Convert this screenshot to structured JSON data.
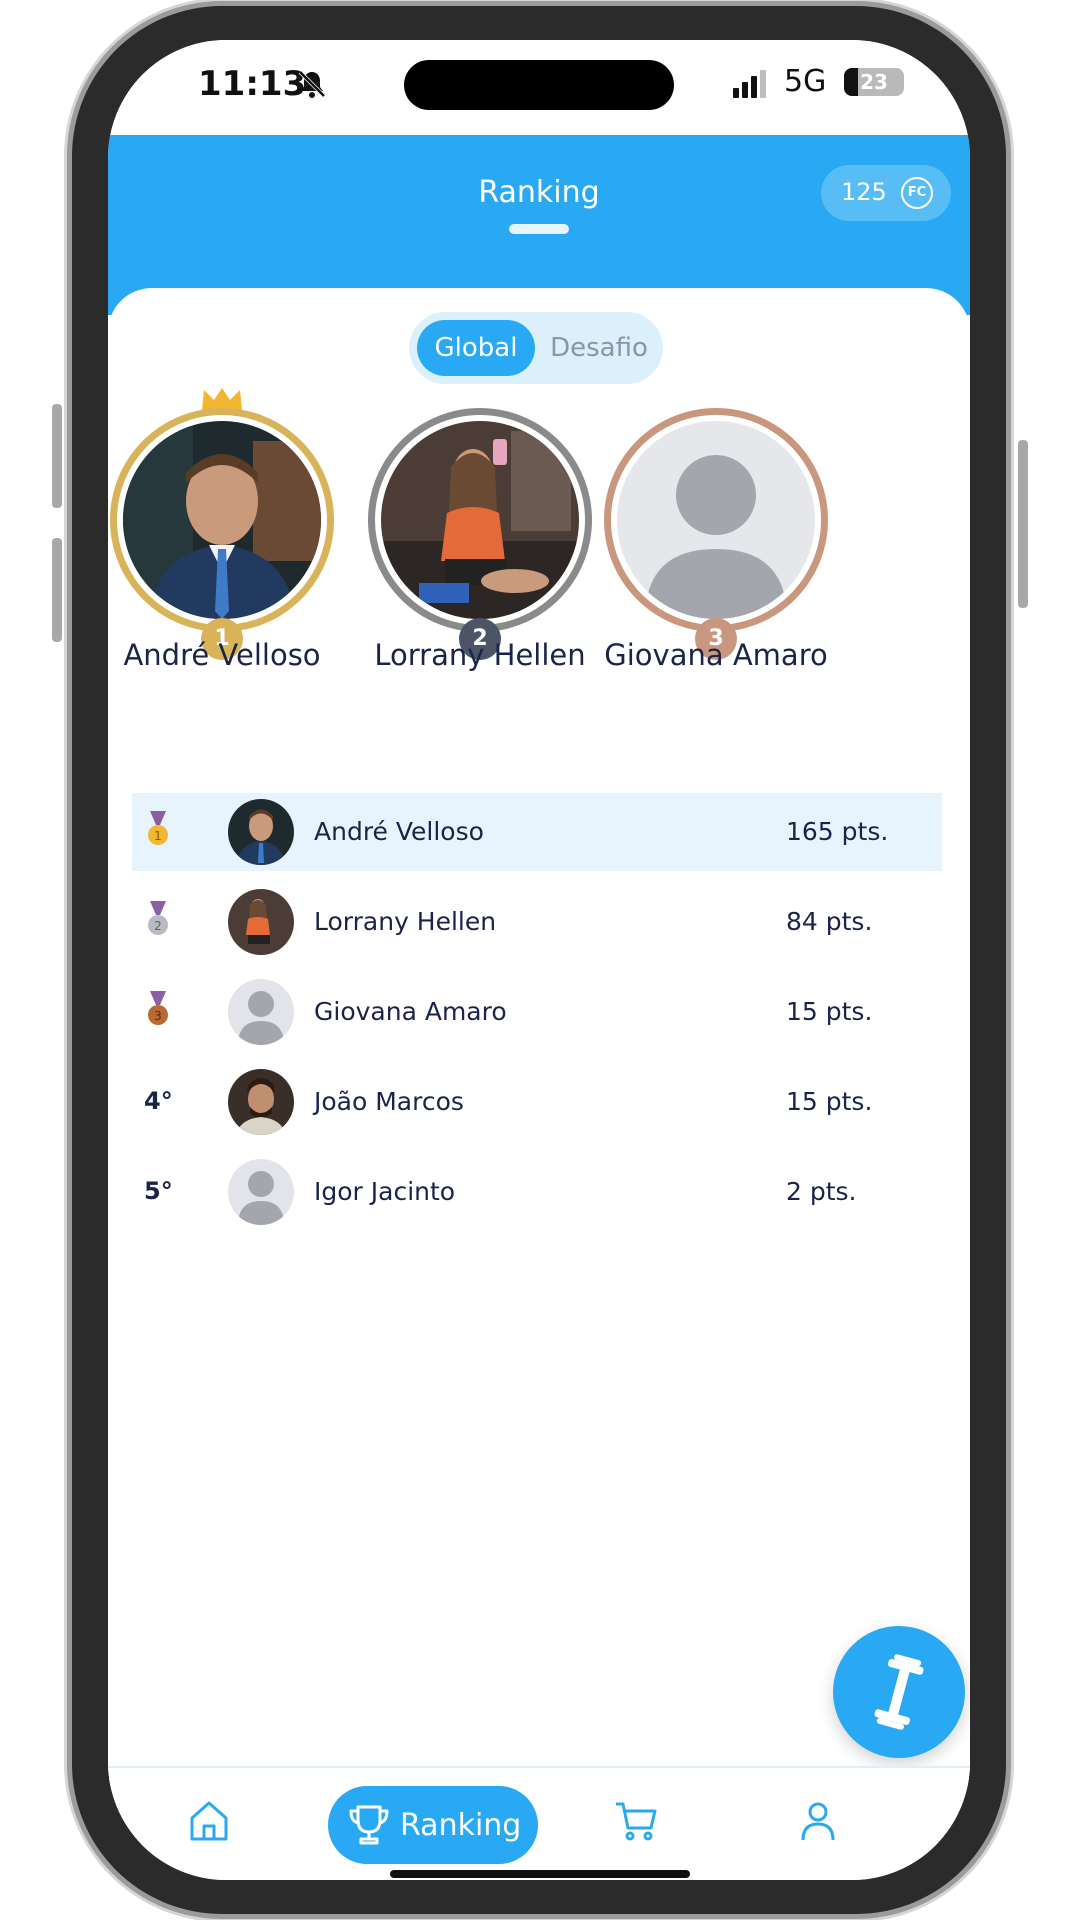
{
  "status_bar": {
    "time": "11:13",
    "network": "5G",
    "battery": "23",
    "battery_level": 0.23
  },
  "header": {
    "title": "Ranking",
    "coins": "125",
    "coin_label": "FC"
  },
  "toggle": {
    "active": "Global",
    "inactive": "Desafio"
  },
  "podium": [
    {
      "rank": "1",
      "name": "André Velloso"
    },
    {
      "rank": "2",
      "name": "Lorrany Hellen"
    },
    {
      "rank": "3",
      "name": "Giovana Amaro"
    }
  ],
  "ranking": [
    {
      "rank": "1",
      "medal": "gold-medal-icon",
      "name": "André Velloso",
      "points": "165 pts."
    },
    {
      "rank": "2",
      "medal": "silver-medal-icon",
      "name": "Lorrany Hellen",
      "points": "84 pts."
    },
    {
      "rank": "3",
      "medal": "bronze-medal-icon",
      "name": "Giovana Amaro",
      "points": "15 pts."
    },
    {
      "rank": "4°",
      "name": "João Marcos",
      "points": "15 pts."
    },
    {
      "rank": "5°",
      "name": "Igor Jacinto",
      "points": "2 pts."
    }
  ],
  "nav": {
    "active_label": "Ranking"
  },
  "colors": {
    "primary": "#29a9f3",
    "gold": "#d8b35a",
    "silver": "#8a8a8a",
    "bronze": "#c9977d",
    "text": "#1a2448"
  }
}
